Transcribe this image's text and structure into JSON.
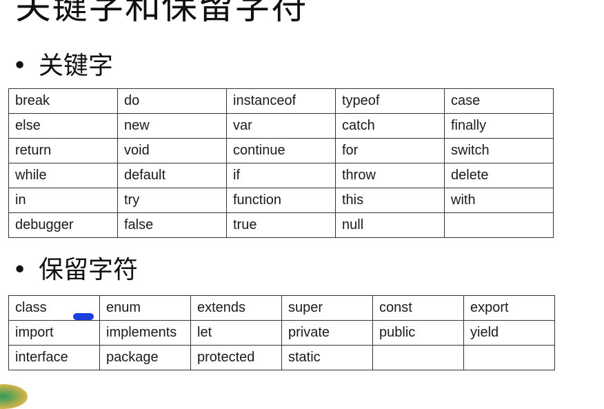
{
  "title": "关键字和保留字符",
  "keywords_heading": "关键字",
  "reserved_heading": "保留字符",
  "bullet": "•",
  "keywords_table": [
    [
      "break",
      "do",
      "instanceof",
      "typeof",
      "case"
    ],
    [
      "else",
      "new",
      "var",
      "catch",
      "finally"
    ],
    [
      "return",
      "void",
      "continue",
      "for",
      "switch"
    ],
    [
      "while",
      "default",
      "if",
      "throw",
      "delete"
    ],
    [
      "in",
      "try",
      "function",
      "this",
      "with"
    ],
    [
      "debugger",
      "false",
      "true",
      "null",
      ""
    ]
  ],
  "reserved_table": [
    [
      "class",
      "enum",
      "extends",
      "super",
      "const",
      "export"
    ],
    [
      "import",
      "implements",
      "let",
      "private",
      "public",
      "yield"
    ],
    [
      "interface",
      "package",
      "protected",
      "static",
      "",
      ""
    ]
  ],
  "colors": {
    "pen_mark": "#1c3fe0",
    "border": "#333333"
  }
}
